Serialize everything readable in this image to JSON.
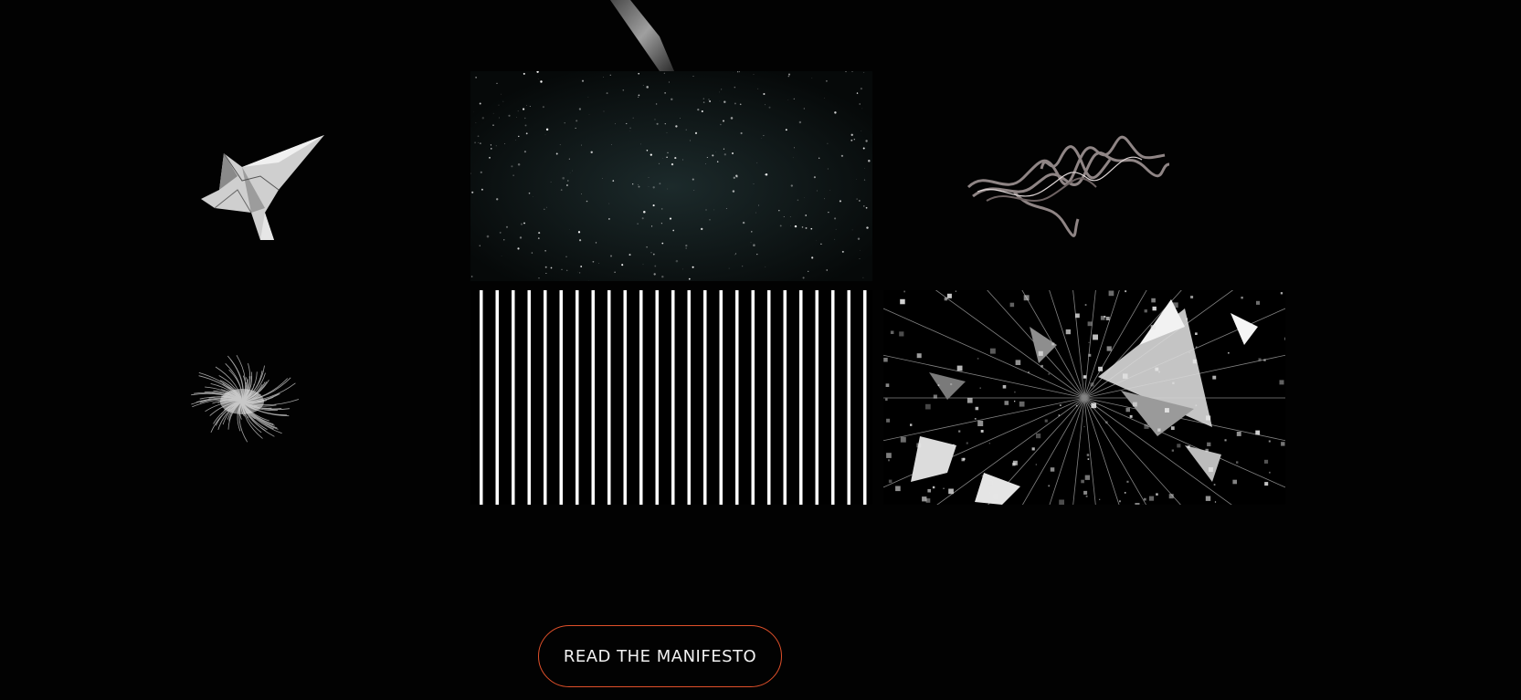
{
  "cta": {
    "label": "READ THE MANIFESTO"
  },
  "colors": {
    "background": "#020202",
    "cta_border": "#e0502a",
    "cta_text": "#f2f2f2"
  },
  "tiles": [
    {
      "name": "origami-bird",
      "kind": "artwork"
    },
    {
      "name": "starfield",
      "kind": "artwork"
    },
    {
      "name": "scribble-ribbon",
      "kind": "artwork"
    },
    {
      "name": "fur-tuft",
      "kind": "artwork"
    },
    {
      "name": "vertical-stripes",
      "kind": "artwork"
    },
    {
      "name": "shattered-shards",
      "kind": "artwork"
    }
  ]
}
